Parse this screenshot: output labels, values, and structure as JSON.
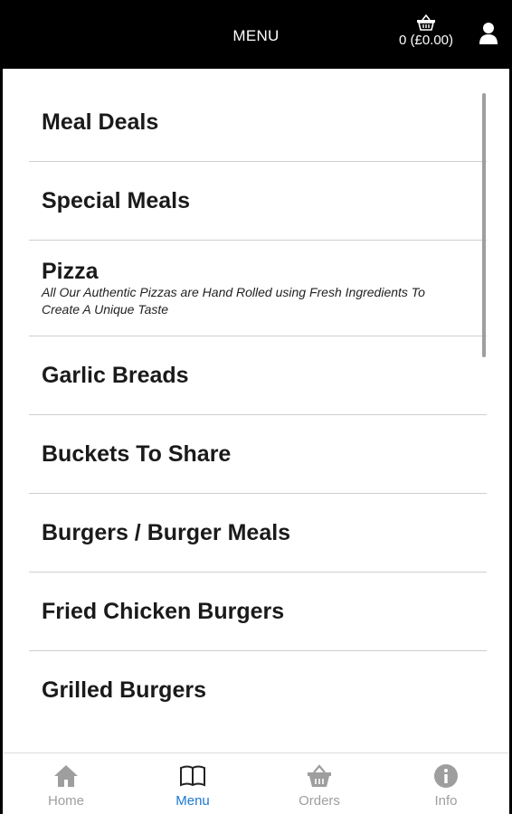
{
  "header": {
    "title": "MENU",
    "cart_total": "0 (£0.00)",
    "cart_icon": "basket-icon",
    "account_icon": "user-icon"
  },
  "menu": {
    "items": [
      {
        "label": "Meal Deals"
      },
      {
        "label": "Special Meals"
      },
      {
        "label": "Pizza",
        "description": "All Our Authentic Pizzas are Hand Rolled using Fresh Ingredients To Create A Unique Taste"
      },
      {
        "label": "Garlic Breads"
      },
      {
        "label": "Buckets To Share"
      },
      {
        "label": "Burgers / Burger Meals"
      },
      {
        "label": "Fried Chicken Burgers"
      },
      {
        "label": "Grilled Burgers"
      }
    ]
  },
  "tabbar": {
    "tabs": [
      {
        "label": "Home",
        "icon": "home-icon"
      },
      {
        "label": "Menu",
        "icon": "book-icon",
        "active": true
      },
      {
        "label": "Orders",
        "icon": "basket-icon"
      },
      {
        "label": "Info",
        "icon": "info-icon"
      }
    ]
  },
  "colors": {
    "header_bg": "#000000",
    "active_tab": "#1b77d2",
    "inactive_tab": "#9e9e9e",
    "divider": "#cfcfcf"
  }
}
